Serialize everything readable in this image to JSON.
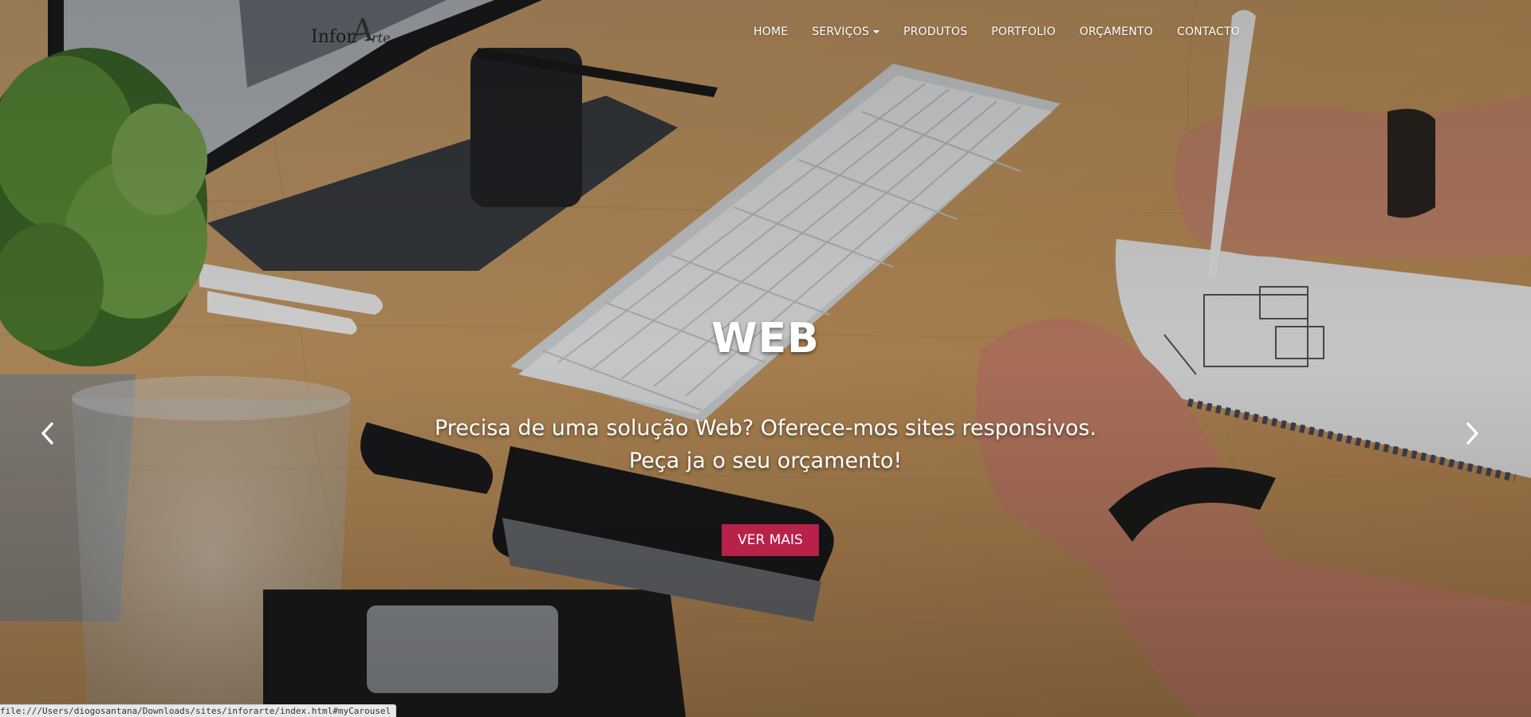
{
  "brand": {
    "logo_text": "Infor",
    "logo_script": "A",
    "logo_script_tail": "rte"
  },
  "nav": {
    "items": [
      {
        "label": "HOME"
      },
      {
        "label": "SERVIÇOS",
        "has_dropdown": true
      },
      {
        "label": "PRODUTOS"
      },
      {
        "label": "PORTFOLIO"
      },
      {
        "label": "ORÇAMENTO"
      },
      {
        "label": "CONTACTO"
      }
    ]
  },
  "carousel": {
    "title": "WEB",
    "line1": "Precisa de uma solução Web? Oferece-mos sites responsivos.",
    "line2": "Peça ja o seu orçamento!",
    "cta_label": "VER MAIS",
    "prev_icon": "chevron-left-icon",
    "next_icon": "chevron-right-icon"
  },
  "statusbar": {
    "url": "file:///Users/diogosantana/Downloads/sites/inforarte/index.html#myCarousel"
  },
  "colors": {
    "cta": "#b8214a",
    "text_light": "#ffffff",
    "desk_wood": "#c79a66"
  }
}
